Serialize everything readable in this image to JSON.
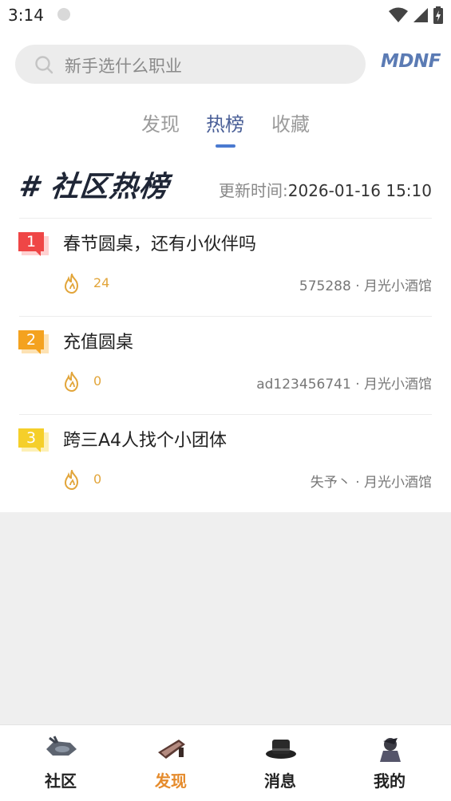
{
  "status_bar": {
    "time": "3:14"
  },
  "search": {
    "placeholder": "新手选什么职业"
  },
  "brand": {
    "logo_text": "MDNF"
  },
  "tabs": [
    {
      "label": "发现",
      "active": false
    },
    {
      "label": "热榜",
      "active": true
    },
    {
      "label": "收藏",
      "active": false
    }
  ],
  "ranking": {
    "title": "# 社区热榜",
    "update_label": "更新时间:",
    "update_time": "2026-01-16 15:10",
    "items": [
      {
        "rank": "1",
        "title": "春节圆桌，还有小伙伴吗",
        "heat": "24",
        "author": "575288",
        "separator": "·",
        "board": "月光小酒馆",
        "badge_color": "#ef4646"
      },
      {
        "rank": "2",
        "title": "充值圆桌",
        "heat": "0",
        "author": "ad123456741",
        "separator": "·",
        "board": "月光小酒馆",
        "badge_color": "#f4a21f"
      },
      {
        "rank": "3",
        "title": "跨三A4人找个小团体",
        "heat": "0",
        "author": "失予丶",
        "separator": "·",
        "board": "月光小酒馆",
        "badge_color": "#f5cf2a"
      }
    ]
  },
  "bottom_nav": [
    {
      "label": "社区",
      "icon": "community-icon",
      "active": false
    },
    {
      "label": "发现",
      "icon": "discover-icon",
      "active": true
    },
    {
      "label": "消息",
      "icon": "message-icon",
      "active": false
    },
    {
      "label": "我的",
      "icon": "profile-icon",
      "active": false
    }
  ],
  "colors": {
    "accent_tab": "#4a5f97",
    "indicator": "#4a7ad0",
    "nav_active": "#e58b2c",
    "heat": "#e2a53a"
  }
}
